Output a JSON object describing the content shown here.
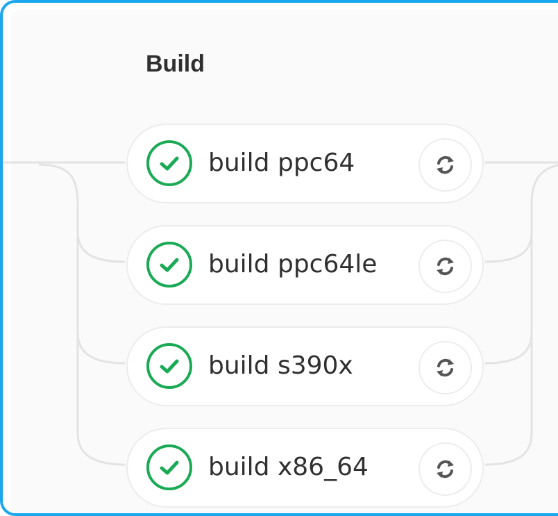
{
  "pipeline": {
    "stage": {
      "title": "Build",
      "jobs": [
        {
          "name": "build ppc64",
          "status": "success",
          "action_icon": "retry-icon"
        },
        {
          "name": "build ppc64le",
          "status": "success",
          "action_icon": "retry-icon"
        },
        {
          "name": "build s390x",
          "status": "success",
          "action_icon": "retry-icon"
        },
        {
          "name": "build x86_64",
          "status": "success",
          "action_icon": "retry-icon"
        }
      ]
    }
  },
  "colors": {
    "frame_border": "#1aa7ec",
    "success": "#1aaa55",
    "text": "#303030",
    "connector": "#e5e5e5",
    "icon": "#555555"
  }
}
